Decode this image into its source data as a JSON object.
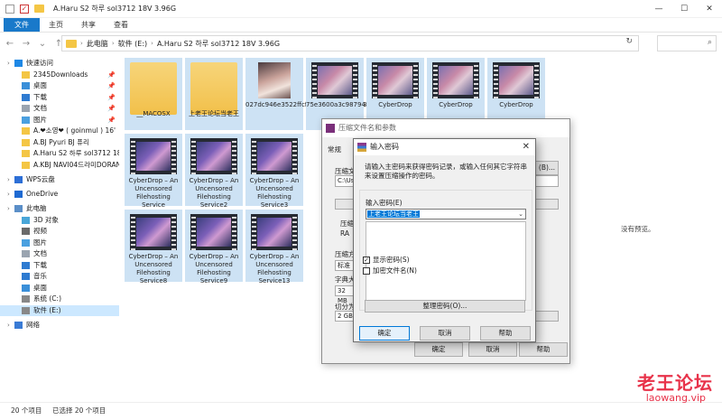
{
  "window": {
    "title": "A.Haru S2 하루  sol3712 18V 3.96G",
    "minimize": "—",
    "maximize": "☐",
    "close": "✕"
  },
  "ribbon": {
    "tabs": [
      "文件",
      "主页",
      "共享",
      "查看"
    ]
  },
  "address": {
    "back": "←",
    "forward": "→",
    "recent": "⌄",
    "up": "↑",
    "segments": [
      "此电脑",
      "软件 (E:)",
      "A.Haru S2 하루  sol3712 18V 3.96G"
    ],
    "refresh": "↻",
    "search_icon": "⌕"
  },
  "sidebar": {
    "items": [
      {
        "label": "快速访问",
        "icon": "star-icon",
        "pinned": false
      },
      {
        "label": "2345Downloads",
        "icon": "folder-icon",
        "pinned": true
      },
      {
        "label": "桌面",
        "icon": "desktop-icon",
        "pinned": true
      },
      {
        "label": "下载",
        "icon": "download-icon",
        "pinned": true
      },
      {
        "label": "文档",
        "icon": "document-icon",
        "pinned": true
      },
      {
        "label": "图片",
        "icon": "picture-icon",
        "pinned": true
      },
      {
        "label": "A.❤소영❤ ( goinmul ) 16'",
        "icon": "folder-icon",
        "pinned": false
      },
      {
        "label": "A.BJ Pyuri  BJ 퓨리",
        "icon": "folder-icon",
        "pinned": false
      },
      {
        "label": "A.Haru S2 하루  sol3712 18",
        "icon": "folder-icon",
        "pinned": false
      },
      {
        "label": "A.KBJ NAVI04드라미DORAN",
        "icon": "folder-icon",
        "pinned": false
      },
      {
        "label": "WPS云盘",
        "icon": "cloud-icon",
        "pinned": false
      },
      {
        "label": "OneDrive",
        "icon": "onedrive-icon",
        "pinned": false
      },
      {
        "label": "此电脑",
        "icon": "computer-icon",
        "pinned": false
      },
      {
        "label": "3D 对象",
        "icon": "3d-objects-icon",
        "pinned": false
      },
      {
        "label": "视频",
        "icon": "video-icon",
        "pinned": false
      },
      {
        "label": "图片",
        "icon": "picture-icon",
        "pinned": false
      },
      {
        "label": "文档",
        "icon": "document-icon",
        "pinned": false
      },
      {
        "label": "下载",
        "icon": "download-icon",
        "pinned": false
      },
      {
        "label": "音乐",
        "icon": "music-icon",
        "pinned": false
      },
      {
        "label": "桌面",
        "icon": "desktop-icon",
        "pinned": false
      },
      {
        "label": "系统 (C:)",
        "icon": "drive-icon",
        "pinned": false
      },
      {
        "label": "软件 (E:)",
        "icon": "drive-icon",
        "pinned": false
      },
      {
        "label": "网络",
        "icon": "network-icon",
        "pinned": false
      }
    ]
  },
  "files": [
    {
      "name": "__MACOSX",
      "kind": "folder"
    },
    {
      "name": "上老王论坛当老王",
      "kind": "folder"
    },
    {
      "name": "027dc946e3522ffcf24109a75e80a153.mp4",
      "kind": "photo"
    },
    {
      "name": "75e3600a3c98794",
      "kind": "film"
    },
    {
      "name": "CyberDrop",
      "kind": "film"
    },
    {
      "name": "CyberDrop",
      "kind": "film"
    },
    {
      "name": "CyberDrop",
      "kind": "film"
    },
    {
      "name": "CyberDrop – An Uncensored Filehosting Service",
      "kind": "stage"
    },
    {
      "name": "CyberDrop – An Uncensored Filehosting Service2",
      "kind": "stage"
    },
    {
      "name": "CyberDrop – An Uncensored Filehosting Service3",
      "kind": "stage"
    },
    {
      "name": "CyberDrop – An Uncensored Filehosting Service8",
      "kind": "stage"
    },
    {
      "name": "CyberDrop – An Uncensored Filehosting Service9",
      "kind": "stage"
    },
    {
      "name": "CyberDrop – An Uncensored Filehosting Service13",
      "kind": "stage"
    }
  ],
  "preview_text": "没有预览。",
  "status": {
    "count": "20 个项目",
    "selected": "已选择 20 个项目"
  },
  "archive_dialog": {
    "title": "压缩文件名和参数",
    "tab": "常规",
    "labels": {
      "name": "压缩文",
      "path": "C:\\Use",
      "format": "压缩",
      "rar": "RA",
      "method": "压缩方",
      "method_val": "标准",
      "dict": "字典大",
      "dict_val": "32 MB",
      "split": "切分为",
      "split_val": "2 GB"
    },
    "browse": "(B)...",
    "ok": "确定",
    "cancel": "取消",
    "help": "帮助"
  },
  "password_dialog": {
    "title": "输入密码",
    "close": "✕",
    "hint": "请输入主密码来获得密码记录，或输入任何其它字符串来设置压缩操作的密码。",
    "label": "输入密码(E)",
    "value": "上老王论坛当老王",
    "dropdown": "⌄",
    "show_password": "显示密码(S)",
    "show_password_checked": true,
    "encrypt_names": "加密文件名(N)",
    "encrypt_names_checked": false,
    "organize": "整理密码(O)...",
    "ok": "确定",
    "cancel": "取消",
    "help": "帮助"
  },
  "watermark": {
    "title": "老王论坛",
    "url": "laowang.vip"
  }
}
